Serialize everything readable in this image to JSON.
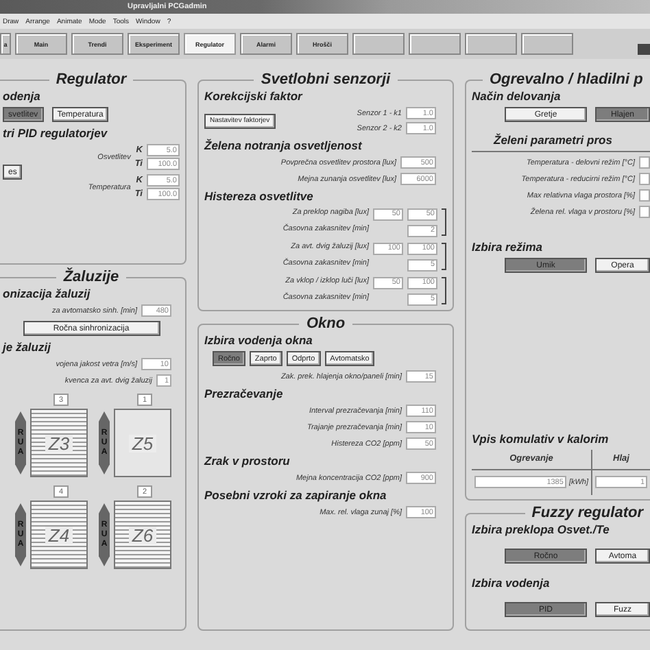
{
  "window": {
    "title": "Upravljalni PCGadmin"
  },
  "menu": [
    "Draw",
    "Arrange",
    "Animate",
    "Mode",
    "Tools",
    "Window",
    "?"
  ],
  "tabs": [
    {
      "kind": "label",
      "label": "a",
      "selected": false
    },
    {
      "kind": "label",
      "label": "Main",
      "selected": false
    },
    {
      "kind": "label",
      "label": "Trendi",
      "selected": false
    },
    {
      "kind": "label",
      "label": "Eksperiment",
      "selected": false
    },
    {
      "kind": "label",
      "label": "Regulator",
      "selected": true
    },
    {
      "kind": "label",
      "label": "Alarmi",
      "selected": false
    },
    {
      "kind": "label",
      "label": "Hrošči",
      "selected": false
    },
    {
      "kind": "blank",
      "selected": false
    },
    {
      "kind": "blank",
      "selected": false
    },
    {
      "kind": "blank",
      "selected": false
    },
    {
      "kind": "blank",
      "selected": false
    }
  ],
  "regulator": {
    "title": "Regulator",
    "mode_heading": "odenja",
    "mode_buttons": [
      {
        "label": "svetlitev",
        "selected": true
      },
      {
        "label": "Temperatura",
        "selected": false
      }
    ],
    "pid_heading": "tri PID regulatorjev",
    "side_button": "es",
    "groups": [
      {
        "name": "Osvetlitev",
        "params": [
          {
            "label": "K",
            "value": "5.0"
          },
          {
            "label": "Ti",
            "value": "100.0"
          }
        ]
      },
      {
        "name": "Temperatura",
        "params": [
          {
            "label": "K",
            "value": "5.0"
          },
          {
            "label": "Ti",
            "value": "100.0"
          }
        ]
      }
    ]
  },
  "blinds_panel": {
    "title": "Žaluzije",
    "sync_heading": "onizacija žaluzij",
    "sync_fields": [
      {
        "label": "za avtomatsko sinh. [min]",
        "value": "480"
      }
    ],
    "sync_button": "Ročna sinhronizacija",
    "auto_heading": "je žaluzij",
    "auto_fields": [
      {
        "label": "vojena jakost vetra [m/s]",
        "value": "10"
      },
      {
        "label": "kvenca za avt. dvig žaluzij",
        "value": "1"
      }
    ],
    "blinds": [
      {
        "name": "Z3",
        "order": "3",
        "slats": true,
        "letters": [
          "R",
          "U",
          "A"
        ]
      },
      {
        "name": "Z5",
        "order": "1",
        "slats": false,
        "letters": [
          "R",
          "U",
          "A"
        ]
      },
      {
        "name": "Z4",
        "order": "4",
        "slats": true,
        "letters": [
          "R",
          "U",
          "A"
        ]
      },
      {
        "name": "Z6",
        "order": "2",
        "slats": true,
        "letters": [
          "R",
          "U",
          "A"
        ]
      }
    ]
  },
  "light_sensors": {
    "title": "Svetlobni senzorji",
    "correction_heading": "Korekcijski faktor",
    "correction_button": "Nastavitev faktorjev",
    "correction_fields": [
      {
        "label": "Senzor 1 - k1",
        "value": "1.0"
      },
      {
        "label": "Senzor 2 - k2",
        "value": "1.0"
      }
    ],
    "desired_heading": "Želena notranja osvetljenost",
    "desired_fields": [
      {
        "label": "Povprečna osvetlitev prostora [lux]",
        "value": "500"
      },
      {
        "label": "Mejna zunanja osvetlitev [lux]",
        "value": "6000"
      }
    ],
    "hysteresis_heading": "Histereza osvetlitve",
    "hysteresis": [
      {
        "label": "Za preklop nagiba [lux]",
        "value_a": "50",
        "value_b": "50",
        "delay_label": "Časovna zakasnitev [min]",
        "delay": "2"
      },
      {
        "label": "Za avt. dvig žaluzij [lux]",
        "value_a": "100",
        "value_b": "100",
        "delay_label": "Časovna zakasnitev [min]",
        "delay": "5"
      },
      {
        "label": "Za vklop / izklop luči [lux]",
        "value_a": "50",
        "value_b": "100",
        "delay_label": "Časovna zakasnitev [min]",
        "delay": "5"
      }
    ]
  },
  "window_panel": {
    "title": "Okno",
    "control_heading": "Izbira vodenja okna",
    "control_buttons": [
      {
        "label": "Ročno",
        "selected": true
      },
      {
        "label": "Zaprto",
        "selected": false
      },
      {
        "label": "Odprto",
        "selected": false
      },
      {
        "label": "Avtomatsko",
        "selected": false
      }
    ],
    "items": [
      {
        "kind": "field",
        "label": "Zak. prek. hlajenja okno/paneli [min]",
        "value": "15"
      },
      {
        "kind": "heading",
        "text": "Prezračevanje"
      },
      {
        "kind": "field",
        "label": "Interval prezračevanja [min]",
        "value": "110"
      },
      {
        "kind": "field",
        "label": "Trajanje prezračevanja [min]",
        "value": "10"
      },
      {
        "kind": "field",
        "label": "Histereza CO2 [ppm]",
        "value": "50"
      },
      {
        "kind": "heading",
        "text": "Zrak v prostoru"
      },
      {
        "kind": "field",
        "label": "Mejna koncentracija CO2 [ppm]",
        "value": "900"
      },
      {
        "kind": "heading",
        "text": "Posebni vzroki za zapiranje okna"
      },
      {
        "kind": "field",
        "label": "Max. rel. vlaga zunaj [%]",
        "value": "100"
      }
    ]
  },
  "heating": {
    "title": "Ogrevalno / hladilni p",
    "mode_heading": "Način delovanja",
    "mode_buttons": [
      {
        "label": "Gretje",
        "selected": false
      },
      {
        "label": "Hlajen",
        "selected": true
      }
    ],
    "params_heading": "Želeni parametri pros",
    "params": [
      {
        "label": "Temperatura - delovni režim [°C]"
      },
      {
        "label": "Temperatura - reducirni režim [°C]"
      },
      {
        "label": "Max relativna vlaga prostora [%]"
      },
      {
        "label": "Želena rel. vlaga v prostoru [%]"
      }
    ],
    "regime_heading": "Izbira režima",
    "regime_buttons": [
      {
        "label": "Umik",
        "selected": true
      },
      {
        "label": "Opera",
        "selected": false
      }
    ],
    "meter_heading": "Vpis komulativ v kalorim",
    "meters": [
      {
        "label": "Ogrevanje",
        "value": "1385",
        "unit": "[kWh]"
      },
      {
        "label": "Hlaj",
        "value": "1"
      }
    ]
  },
  "fuzzy": {
    "title": "Fuzzy regulator",
    "switch_heading": "Izbira preklopa Osvet./Te",
    "switch_buttons": [
      {
        "label": "Ročno",
        "selected": true
      },
      {
        "label": "Avtoma",
        "selected": false
      }
    ],
    "control_heading": "Izbira vodenja",
    "control_buttons": [
      {
        "label": "PID",
        "selected": true
      },
      {
        "label": "Fuzz",
        "selected": false
      }
    ]
  }
}
